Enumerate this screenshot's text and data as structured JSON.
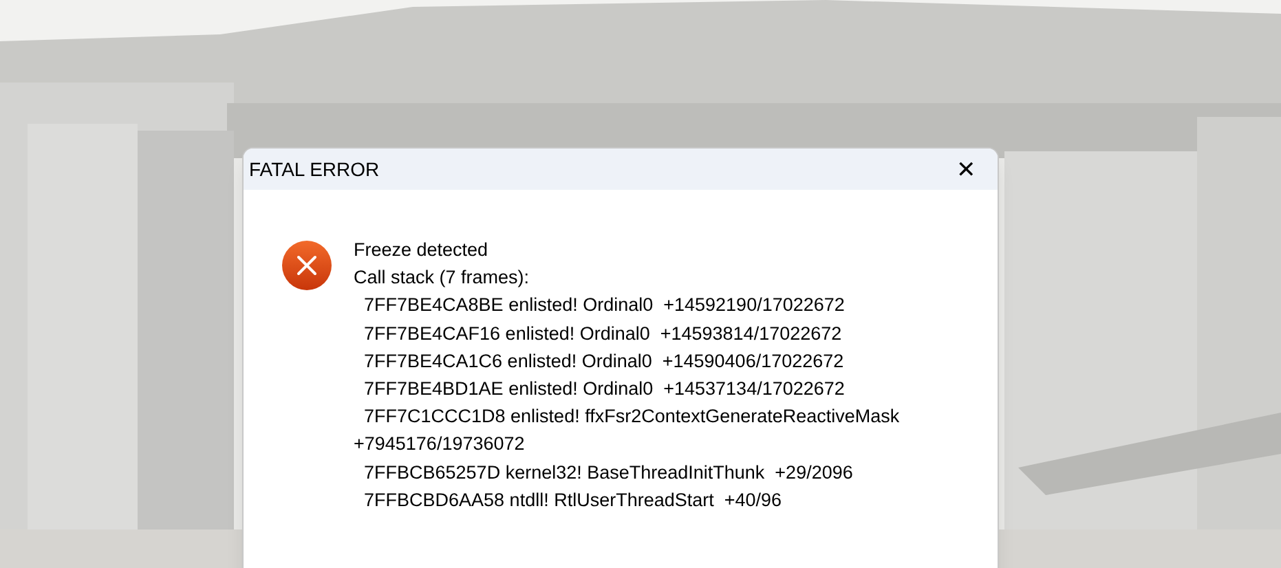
{
  "window": {
    "title": "FATAL ERROR",
    "close": "✕"
  },
  "message": {
    "lines": [
      {
        "kind": "plain",
        "text": "Freeze detected"
      },
      {
        "kind": "plain",
        "text": "Call stack (7 frames):"
      },
      {
        "kind": "frame",
        "text": "7FF7BE4CA8BE enlisted! Ordinal0  +14592190/17022672"
      },
      {
        "kind": "frame",
        "text": "7FF7BE4CAF16 enlisted! Ordinal0  +14593814/17022672"
      },
      {
        "kind": "frame",
        "text": "7FF7BE4CA1C6 enlisted! Ordinal0  +14590406/17022672"
      },
      {
        "kind": "frame",
        "text": "7FF7BE4BD1AE enlisted! Ordinal0  +14537134/17022672"
      },
      {
        "kind": "frame",
        "text": "7FF7C1CCC1D8 enlisted! ffxFsr2ContextGenerateReactiveMask +7945176/19736072"
      },
      {
        "kind": "frame",
        "text": "7FFBCB65257D kernel32! BaseThreadInitThunk  +29/2096"
      },
      {
        "kind": "frame",
        "text": "7FFBCBD6AA58 ntdll! RtlUserThreadStart  +40/96"
      }
    ]
  }
}
